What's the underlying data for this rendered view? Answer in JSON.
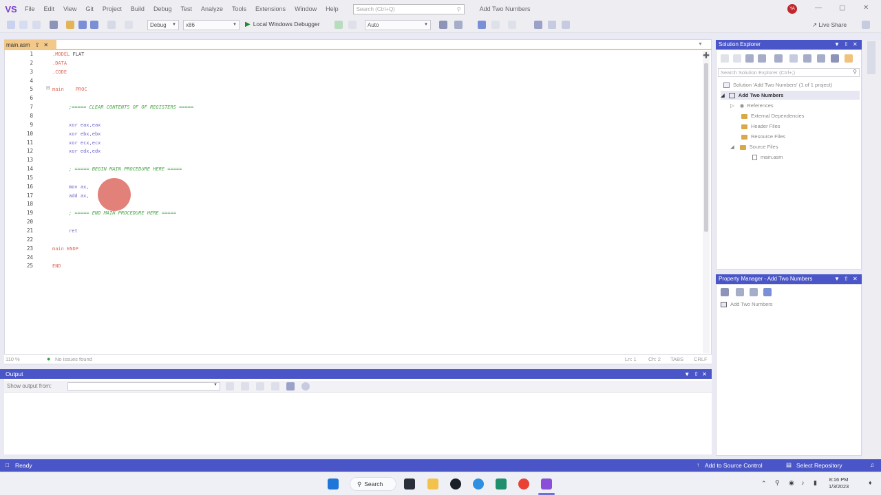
{
  "menubar": {
    "logo": "VS",
    "items": [
      "File",
      "Edit",
      "View",
      "Git",
      "Project",
      "Build",
      "Debug",
      "Test",
      "Analyze",
      "Tools",
      "Extensions",
      "Window",
      "Help"
    ],
    "search_placeholder": "Search (Ctrl+Q)",
    "solution_title": "Add Two Numbers",
    "avatar_initials": "YA",
    "window_buttons": [
      "—",
      "▢",
      "✕"
    ]
  },
  "toolbar": {
    "config": "Debug",
    "platform": "x86",
    "run_label": "Local Windows Debugger",
    "auto": "Auto",
    "live_share": "Live Share"
  },
  "editor": {
    "tab_label": "main.asm",
    "zoom": "110 %",
    "issues": "No issues found",
    "position": "Ln: 1",
    "column": "Ch: 2",
    "tabs_mode": "TABS",
    "line_ending": "CRLF",
    "lines": [
      {
        "n": "1",
        "kw": ".MODEL",
        "rest": " FLAT"
      },
      {
        "n": "2",
        "kw": ".DATA",
        "rest": ""
      },
      {
        "n": "3",
        "kw": ".CODE",
        "rest": ""
      },
      {
        "n": "4",
        "kw": "",
        "rest": ""
      },
      {
        "n": "5",
        "kw": "main",
        "rest": "    PROC"
      },
      {
        "n": "6",
        "kw": "",
        "rest": ""
      },
      {
        "n": "7",
        "kw": "",
        "rest": ";===== CLEAR CONTENTS OF OF REGISTERS ====="
      },
      {
        "n": "8",
        "kw": "",
        "rest": ""
      },
      {
        "n": "9",
        "kw": "xor",
        "rest": " eax,eax"
      },
      {
        "n": "10",
        "kw": "xor",
        "rest": " ebx,ebx"
      },
      {
        "n": "11",
        "kw": "xor",
        "rest": " ecx,ecx"
      },
      {
        "n": "12",
        "kw": "xor",
        "rest": " edx,edx"
      },
      {
        "n": "13",
        "kw": "",
        "rest": ""
      },
      {
        "n": "14",
        "kw": "",
        "rest": "; ===== BEGIN MAIN PROCEDURE HERE ====="
      },
      {
        "n": "15",
        "kw": "",
        "rest": ""
      },
      {
        "n": "16",
        "kw": "mov",
        "rest": " ax,"
      },
      {
        "n": "17",
        "kw": "add",
        "rest": " ax,"
      },
      {
        "n": "18",
        "kw": "",
        "rest": ""
      },
      {
        "n": "19",
        "kw": "",
        "rest": "; ===== END MAIN PROCEDURE HERE ====="
      },
      {
        "n": "20",
        "kw": "",
        "rest": ""
      },
      {
        "n": "21",
        "kw": "ret",
        "rest": ""
      },
      {
        "n": "22",
        "kw": "",
        "rest": ""
      },
      {
        "n": "23",
        "kw": "main",
        "rest": " ENDP"
      },
      {
        "n": "24",
        "kw": "",
        "rest": ""
      },
      {
        "n": "25",
        "kw": "END",
        "rest": ""
      }
    ]
  },
  "output": {
    "title": "Output",
    "show_from_label": "Show output from:"
  },
  "solution_explorer": {
    "title": "Solution Explorer",
    "search_placeholder": "Search Solution Explorer (Ctrl+;)",
    "solution": "Solution 'Add Two Numbers' (1 of 1 project)",
    "project": "Add Two Numbers",
    "references": "References",
    "external": "External Dependencies",
    "headers": "Header Files",
    "resources": "Resource Files",
    "sources": "Source Files",
    "main_file": "main.asm"
  },
  "property_manager": {
    "title": "Property Manager - Add Two Numbers",
    "item": "Add Two Numbers"
  },
  "statusbar": {
    "ready": "Ready",
    "source_control": "Add to Source Control",
    "repository": "Select Repository"
  },
  "taskbar": {
    "search": "Search",
    "time": "8:16 PM",
    "date": "1/3/2023"
  },
  "colors": {
    "accent": "#4a55c7",
    "tab_active": "#f3c98b",
    "keyword": "#e06a5a",
    "comment": "#4aa94a"
  }
}
